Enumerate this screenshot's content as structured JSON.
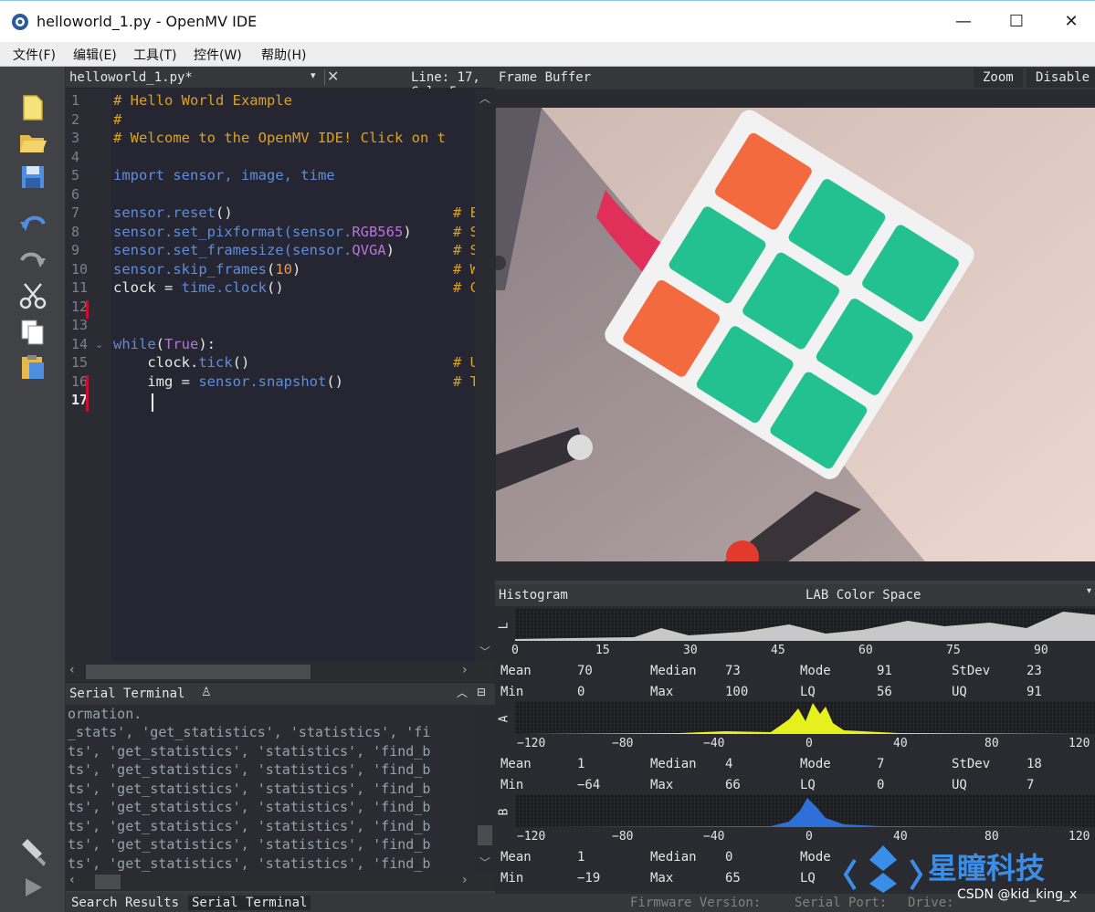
{
  "window": {
    "title": "helloworld_1.py - OpenMV IDE",
    "minimize": "—",
    "maximize": "☐",
    "close": "✕"
  },
  "menu": [
    "文件(F)",
    "编辑(E)",
    "工具(T)",
    "控件(W)",
    "帮助(H)"
  ],
  "toolbar": {
    "icons": [
      "new-file-icon",
      "open-folder-icon",
      "save-icon",
      "undo-icon",
      "redo-icon",
      "cut-icon",
      "copy-icon",
      "paste-icon",
      "connect-icon",
      "run-icon"
    ]
  },
  "editor": {
    "tab_name": "helloworld_1.py*",
    "dropdown": "▾",
    "close": "✕",
    "position": "Line: 17, Col: 5",
    "line_numbers": [
      "1",
      "2",
      "3",
      "4",
      "5",
      "6",
      "7",
      "8",
      "9",
      "10",
      "11",
      "12",
      "13",
      "14",
      "15",
      "16",
      "17"
    ],
    "code": {
      "l1": "# Hello World Example",
      "l2": "#",
      "l3": "# Welcome to the OpenMV IDE! Click on t",
      "l5_kw": "import",
      "l5_rest": " sensor, image, time",
      "l7_obj": "sensor.",
      "l7_fn": "reset",
      "l7_args": "()",
      "l7_cm": "# E",
      "l8_obj": "sensor.",
      "l8_fn": "set_pixformat",
      "l8_p1": "(sensor.",
      "l8_const": "RGB565",
      "l8_p2": ")",
      "l8_cm": "# S",
      "l9_obj": "sensor.",
      "l9_fn": "set_framesize",
      "l9_p1": "(sensor.",
      "l9_const": "QVGA",
      "l9_p2": ")",
      "l9_cm": "# S",
      "l10_obj": "sensor.",
      "l10_fn": "skip_frames",
      "l10_p1": "(",
      "l10_num": "10",
      "l10_p2": ")",
      "l10_cm": "# W",
      "l11_a": "clock = ",
      "l11_obj": "time.",
      "l11_fn": "clock",
      "l11_args": "()",
      "l11_cm": "# C",
      "l14_kw": "while",
      "l14_p1": "(",
      "l14_const": "True",
      "l14_p2": "):",
      "l15_a": "    clock.",
      "l15_fn": "tick",
      "l15_args": "()",
      "l15_cm": "# U",
      "l16_a": "    img = ",
      "l16_obj": "sensor.",
      "l16_fn": "snapshot",
      "l16_args": "()",
      "l16_cm": "# T"
    }
  },
  "terminal": {
    "title": "Serial Terminal",
    "lines": [
      "ormation.",
      "_stats', 'get_statistics', 'statistics', 'fi",
      "ts', 'get_statistics', 'statistics', 'find_b",
      "ts', 'get_statistics', 'statistics', 'find_b",
      "ts', 'get_statistics', 'statistics', 'find_b",
      "ts', 'get_statistics', 'statistics', 'find_b",
      "ts', 'get_statistics', 'statistics', 'find_b",
      "ts', 'get_statistics', 'statistics', 'find_b",
      "ts', 'get_statistics', 'statistics', 'find_b"
    ]
  },
  "bottom_tabs": [
    "Search Results",
    "Serial Terminal"
  ],
  "frame_buffer": {
    "title": "Frame Buffer",
    "zoom": "Zoom",
    "disable": "Disable"
  },
  "histogram": {
    "title": "Histogram",
    "color_space": "LAB Color Space",
    "channels": [
      {
        "label": "L",
        "ticks": [
          "0",
          "15",
          "30",
          "45",
          "60",
          "75",
          "90"
        ],
        "mean": "70",
        "median": "73",
        "mode": "91",
        "stdev": "23",
        "min": "0",
        "max": "100",
        "lq": "56",
        "uq": "91"
      },
      {
        "label": "A",
        "ticks": [
          "−120",
          "−80",
          "−40",
          "0",
          "40",
          "80",
          "120"
        ],
        "mean": "1",
        "median": "4",
        "mode": "7",
        "stdev": "18",
        "min": "−64",
        "max": "66",
        "lq": "0",
        "uq": "7"
      },
      {
        "label": "B",
        "ticks": [
          "−120",
          "−80",
          "−40",
          "0",
          "40",
          "80",
          "120"
        ],
        "mean": "1",
        "median": "0",
        "mode": "",
        "min": "−19",
        "max": "65",
        "lq": ""
      }
    ],
    "labels": {
      "mean": "Mean",
      "median": "Median",
      "mode": "Mode",
      "stdev": "StDev",
      "min": "Min",
      "max": "Max",
      "lq": "LQ",
      "uq": "UQ"
    }
  },
  "status": {
    "firmware": "Firmware Version:",
    "serial_port": "Serial Port:",
    "drive": "Drive:"
  },
  "watermark": {
    "brand": "星瞳科技",
    "credit": "CSDN @kid_king_x"
  },
  "colors": {
    "cube_green": "#23c18f",
    "cube_orange": "#f26a3d",
    "l_hist": "#c8c8c8",
    "a_hist": "#e6f01c",
    "b_hist": "#2f6fd8"
  }
}
